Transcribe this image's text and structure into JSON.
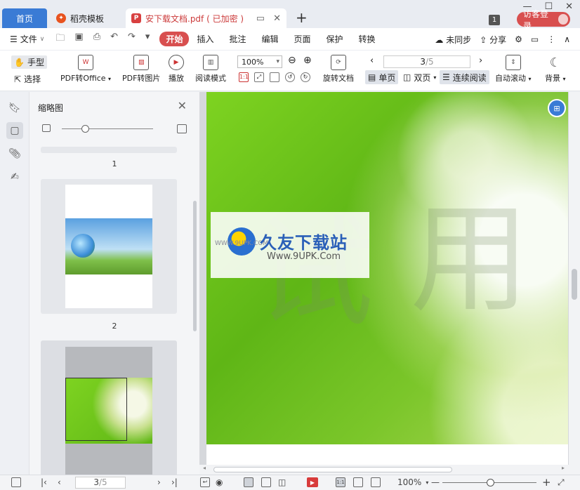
{
  "tabs": {
    "home": "首页",
    "templates": "稻壳模板",
    "document": "安下载文档.pdf ( 已加密 )"
  },
  "titlebar": {
    "badge": "1",
    "login": "访客登录"
  },
  "menu": {
    "file": "文件",
    "tabs": [
      "开始",
      "插入",
      "批注",
      "编辑",
      "页面",
      "保护",
      "转换"
    ],
    "sync": "未同步",
    "share": "分享"
  },
  "ribbon": {
    "hand": "手型",
    "select": "选择",
    "pdf_to_office": "PDF转Office",
    "pdf_to_image": "PDF转图片",
    "play": "播放",
    "read_mode": "阅读模式",
    "zoom": "100%",
    "rotate": "旋转文档",
    "page_current": "3",
    "page_total": "/5",
    "single": "单页",
    "double": "双页",
    "continuous": "连续阅读",
    "auto_scroll": "自动滚动",
    "background": "背景"
  },
  "thumbnails": {
    "title": "缩略图",
    "pages": [
      "1",
      "2"
    ]
  },
  "viewer": {
    "watermark_chars": [
      "试",
      "用"
    ],
    "logo_brand": "久友下载站",
    "logo_url": "Www.9UPK.Com",
    "logo_watermark_url": "WWW.9UPK.COM"
  },
  "statusbar": {
    "page_current": "3",
    "page_total": "/5",
    "zoom": "100%"
  },
  "colors": {
    "accent_blue": "#3a7bd5",
    "accent_red": "#d84f4f",
    "page_green": "#6fc41d"
  }
}
